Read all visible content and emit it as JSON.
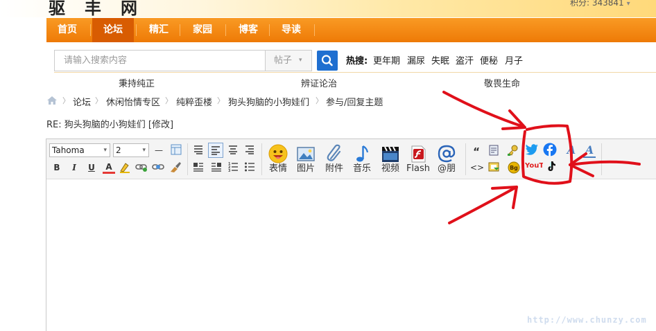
{
  "header": {
    "logo_fragment": "驱丰网",
    "points_label": "积分: 343841",
    "points_chevron": "▾"
  },
  "nav": {
    "items": [
      {
        "label": "首页",
        "active": false
      },
      {
        "label": "论坛",
        "active": true
      },
      {
        "label": "精汇",
        "active": false
      },
      {
        "label": "家园",
        "active": false
      },
      {
        "label": "博客",
        "active": false
      },
      {
        "label": "导读",
        "active": false
      }
    ]
  },
  "search": {
    "placeholder": "请输入搜索内容",
    "category": "帖子",
    "category_chevron": "▾",
    "hot_label": "热搜:",
    "hot_terms": [
      "更年期",
      "漏尿",
      "失眠",
      "盗汗",
      "便秘",
      "月子"
    ]
  },
  "mottos": [
    "秉持纯正",
    "辨证论治",
    "敬畏生命"
  ],
  "breadcrumb": {
    "separator": "〉",
    "items": [
      "论坛",
      "休闲怡情专区",
      "纯粹歪楼",
      "狗头狗脑的小狗娃们",
      "参与/回复主题"
    ]
  },
  "post": {
    "title": "RE: 狗头狗脑的小狗娃们 [修改]"
  },
  "editor": {
    "font_family": "Tahoma",
    "font_size": "2",
    "select_chevron": "▾",
    "big_buttons": [
      "表情",
      "图片",
      "附件",
      "音乐",
      "视频",
      "Flash",
      "@朋"
    ],
    "format_icons": {
      "bold": "B",
      "italic": "I",
      "underline": "U",
      "forecolor": "A",
      "horizontal_rule": "—",
      "quote": "“",
      "code": "<>",
      "font_a": "A",
      "font_a2": "A",
      "bg": "Bg",
      "youtube": "YouTube"
    }
  },
  "watermark": "http://www.chunzy.com",
  "colors": {
    "nav_orange": "#f28a12",
    "nav_active": "#d85c02",
    "search_blue": "#1f6fd0",
    "twitter_blue": "#1d9bf0",
    "facebook_blue": "#1877f2",
    "youtube_red": "#e02020",
    "annotation_red": "#e0101a"
  }
}
